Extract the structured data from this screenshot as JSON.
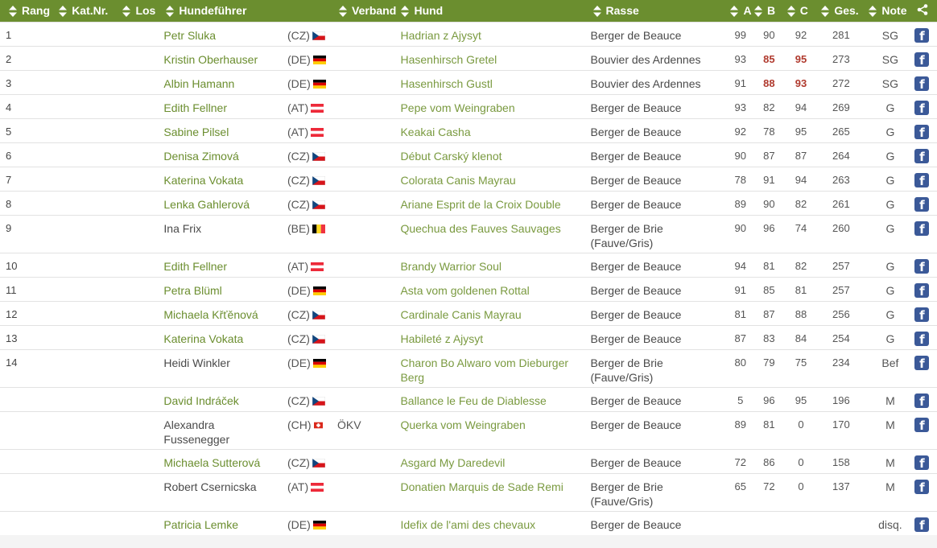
{
  "headers": {
    "rang": "Rang",
    "katnr": "Kat.Nr.",
    "los": "Los",
    "handler": "Hundeführer",
    "verband": "Verband",
    "hund": "Hund",
    "rasse": "Rasse",
    "a": "A",
    "b": "B",
    "c": "C",
    "ges": "Ges.",
    "note": "Note"
  },
  "header_icons": [
    "sort-icon",
    "share-icon"
  ],
  "facebook_label": "f",
  "colors": {
    "header_bg": "#6b8e2f",
    "link": "#6b8e2f",
    "highlight": "#b03a2e",
    "facebook": "#3b5998"
  },
  "rows": [
    {
      "rang": "1",
      "handler": "Petr Sluka",
      "country": "(CZ)",
      "flag": "cz",
      "verband": "",
      "dog": "Hadrian z Ajysyt",
      "breed": "Berger de Beauce",
      "a": "99",
      "b": "90",
      "c": "92",
      "ges": "281",
      "note": "SG"
    },
    {
      "rang": "2",
      "handler": "Kristin Oberhauser",
      "country": "(DE)",
      "flag": "de",
      "verband": "",
      "dog": "Hasenhirsch Gretel",
      "breed": "Bouvier des Ardennes",
      "a": "93",
      "b": "85",
      "c": "95",
      "ges": "273",
      "note": "SG",
      "hl": true
    },
    {
      "rang": "3",
      "handler": "Albin Hamann",
      "country": "(DE)",
      "flag": "de",
      "verband": "",
      "dog": "Hasenhirsch Gustl",
      "breed": "Bouvier des Ardennes",
      "a": "91",
      "b": "88",
      "c": "93",
      "ges": "272",
      "note": "SG",
      "hl": true
    },
    {
      "rang": "4",
      "handler": "Edith Fellner",
      "country": "(AT)",
      "flag": "at",
      "verband": "",
      "dog": "Pepe vom Weingraben",
      "breed": "Berger de Beauce",
      "a": "93",
      "b": "82",
      "c": "94",
      "ges": "269",
      "note": "G"
    },
    {
      "rang": "5",
      "handler": "Sabine Pilsel",
      "country": "(AT)",
      "flag": "at",
      "verband": "",
      "dog": "Keakai Casha",
      "breed": "Berger de Beauce",
      "a": "92",
      "b": "78",
      "c": "95",
      "ges": "265",
      "note": "G"
    },
    {
      "rang": "6",
      "handler": "Denisa Zimová",
      "country": "(CZ)",
      "flag": "cz",
      "verband": "",
      "dog": "Début Carský klenot",
      "breed": "Berger de Beauce",
      "a": "90",
      "b": "87",
      "c": "87",
      "ges": "264",
      "note": "G"
    },
    {
      "rang": "7",
      "handler": "Katerina Vokata",
      "country": "(CZ)",
      "flag": "cz",
      "verband": "",
      "dog": "Colorata Canis Mayrau",
      "breed": "Berger de Beauce",
      "a": "78",
      "b": "91",
      "c": "94",
      "ges": "263",
      "note": "G"
    },
    {
      "rang": "8",
      "handler": "Lenka Gahlerová",
      "country": "(CZ)",
      "flag": "cz",
      "verband": "",
      "dog": "Ariane Esprit de la Croix Double",
      "breed": "Berger de Beauce",
      "a": "89",
      "b": "90",
      "c": "82",
      "ges": "261",
      "note": "G"
    },
    {
      "rang": "9",
      "handler": "Ina Frix",
      "country": "(BE)",
      "flag": "be",
      "verband": "",
      "dog": "Quechua des Fauves Sauvages",
      "breed": "Berger de Brie (Fauve/Gris)",
      "a": "90",
      "b": "96",
      "c": "74",
      "ges": "260",
      "note": "G",
      "tall": true,
      "handlerDark": true
    },
    {
      "rang": "10",
      "handler": "Edith Fellner",
      "country": "(AT)",
      "flag": "at",
      "verband": "",
      "dog": "Brandy Warrior Soul",
      "breed": "Berger de Beauce",
      "a": "94",
      "b": "81",
      "c": "82",
      "ges": "257",
      "note": "G"
    },
    {
      "rang": "11",
      "handler": "Petra Blüml",
      "country": "(DE)",
      "flag": "de",
      "verband": "",
      "dog": "Asta vom goldenen Rottal",
      "breed": "Berger de Beauce",
      "a": "91",
      "b": "85",
      "c": "81",
      "ges": "257",
      "note": "G"
    },
    {
      "rang": "12",
      "handler": "Michaela Křťěnová",
      "country": "(CZ)",
      "flag": "cz",
      "verband": "",
      "dog": "Cardinale Canis Mayrau",
      "breed": "Berger de Beauce",
      "a": "81",
      "b": "87",
      "c": "88",
      "ges": "256",
      "note": "G"
    },
    {
      "rang": "13",
      "handler": "Katerina Vokata",
      "country": "(CZ)",
      "flag": "cz",
      "verband": "",
      "dog": "Habileté z Ajysyt",
      "breed": "Berger de Beauce",
      "a": "87",
      "b": "83",
      "c": "84",
      "ges": "254",
      "note": "G"
    },
    {
      "rang": "14",
      "handler": "Heidi Winkler",
      "country": "(DE)",
      "flag": "de",
      "verband": "",
      "dog": "Charon Bo Alwaro vom Dieburger Berg",
      "breed": "Berger de Brie (Fauve/Gris)",
      "a": "80",
      "b": "79",
      "c": "75",
      "ges": "234",
      "note": "Bef",
      "tall": true,
      "handlerDark": true
    },
    {
      "rang": "",
      "handler": "David Indráček",
      "country": "(CZ)",
      "flag": "cz",
      "verband": "",
      "dog": "Ballance le Feu de Diablesse",
      "breed": "Berger de Beauce",
      "a": "5",
      "b": "96",
      "c": "95",
      "ges": "196",
      "note": "M"
    },
    {
      "rang": "",
      "handler": "Alexandra Fussenegger",
      "country": "(CH)",
      "flag": "ch",
      "verband": "ÖKV",
      "dog": "Querka vom Weingraben",
      "breed": "Berger de Beauce",
      "a": "89",
      "b": "81",
      "c": "0",
      "ges": "170",
      "note": "M",
      "tall": true,
      "handlerDark": true
    },
    {
      "rang": "",
      "handler": "Michaela Sutterová",
      "country": "(CZ)",
      "flag": "cz",
      "verband": "",
      "dog": "Asgard My Daredevil",
      "breed": "Berger de Beauce",
      "a": "72",
      "b": "86",
      "c": "0",
      "ges": "158",
      "note": "M"
    },
    {
      "rang": "",
      "handler": "Robert Csernicska",
      "country": "(AT)",
      "flag": "at",
      "verband": "",
      "dog": "Donatien Marquis de Sade Remi",
      "breed": "Berger de Brie (Fauve/Gris)",
      "a": "65",
      "b": "72",
      "c": "0",
      "ges": "137",
      "note": "M",
      "tall": true,
      "handlerDark": true
    },
    {
      "rang": "",
      "handler": "Patricia Lemke",
      "country": "(DE)",
      "flag": "de",
      "verband": "",
      "dog": "Idefix de l'ami des chevaux",
      "breed": "Berger de Beauce",
      "a": "",
      "b": "",
      "c": "",
      "ges": "",
      "note": "disq.",
      "last": true
    }
  ]
}
